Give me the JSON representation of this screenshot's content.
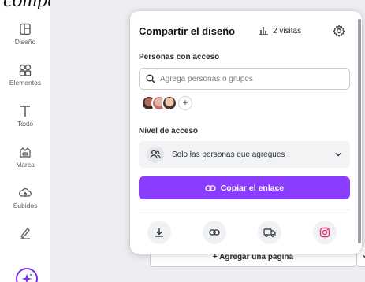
{
  "caption": "compartir:",
  "sidebar": {
    "items": [
      {
        "label": "Diseño",
        "icon": "layout-icon"
      },
      {
        "label": "Elementos",
        "icon": "shapes-icon"
      },
      {
        "label": "Texto",
        "icon": "text-icon"
      },
      {
        "label": "Marca",
        "icon": "crown-icon"
      },
      {
        "label": "Subidos",
        "icon": "upload-cloud-icon"
      },
      {
        "label": "",
        "icon": "draw-icon"
      }
    ],
    "magic_icon": "sparkle-icon"
  },
  "canvas": {
    "add_page_label": "+ Agregar una página"
  },
  "share_panel": {
    "title": "Compartir el diseño",
    "visits_label": "2 visitas",
    "people_section_label": "Personas con acceso",
    "search_placeholder": "Agrega personas o grupos",
    "avatar_add_symbol": "+",
    "access_section_label": "Nivel de acceso",
    "access_value": "Solo las personas que agregues",
    "copy_link_label": "Copiar el enlace",
    "actions": [
      {
        "icon": "download-icon"
      },
      {
        "icon": "link-icon"
      },
      {
        "icon": "truck-icon"
      },
      {
        "icon": "instagram-icon"
      }
    ]
  },
  "colors": {
    "accent": "#8b3dff",
    "instagram": "#e1306c",
    "magic_ring": "#7b2cf0"
  }
}
